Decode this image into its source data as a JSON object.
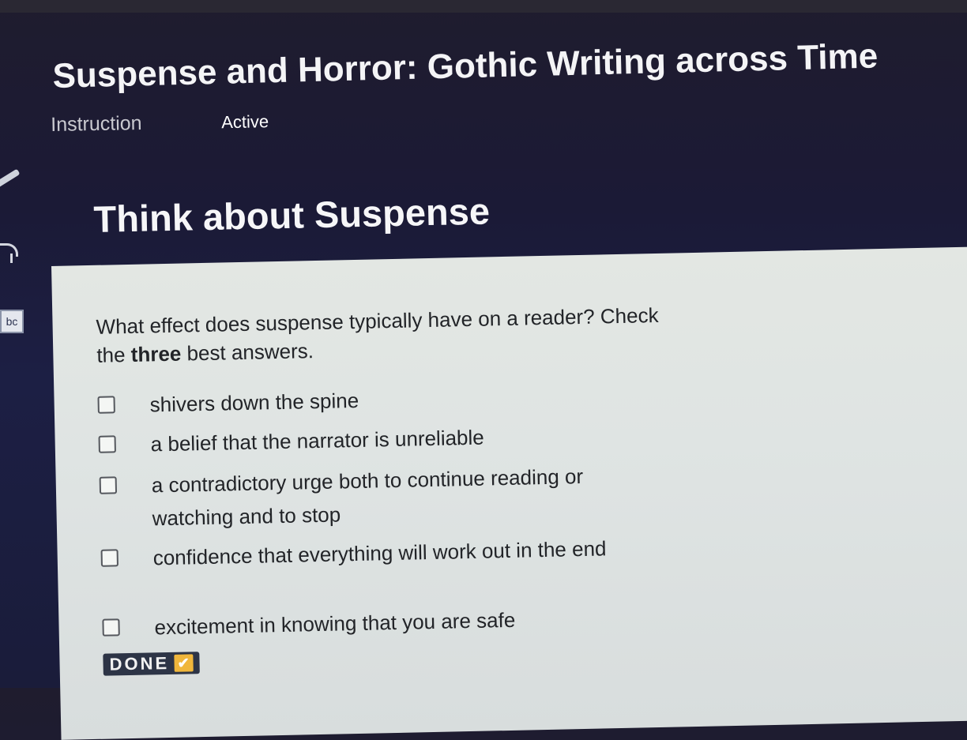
{
  "lesson": {
    "title": "Suspense and Horror: Gothic Writing across Time"
  },
  "tabs": {
    "instruction": "Instruction",
    "status": "Active"
  },
  "sidebar": {
    "translate_label": "bc"
  },
  "section": {
    "title": "Think about Suspense"
  },
  "question": {
    "prompt_before": "What effect does suspense typically have on a reader? Check the ",
    "prompt_emphasis": "three",
    "prompt_after": " best answers.",
    "options": [
      {
        "label": "shivers down the spine",
        "checked": false
      },
      {
        "label": "a belief that the narrator is unreliable",
        "checked": false
      },
      {
        "label": "a contradictory urge both to continue reading or watching and to stop",
        "checked": false
      },
      {
        "label": "confidence that everything will work out in the end",
        "checked": false
      },
      {
        "label": "excitement in knowing that you are safe",
        "checked": false
      }
    ]
  },
  "done_button": {
    "label": "DONE",
    "check": "✔"
  },
  "colors": {
    "header_background": "#1c1f44",
    "panel_background": "#e0e5e3",
    "done_button": "#2d3446",
    "done_check": "#f0b63b"
  }
}
